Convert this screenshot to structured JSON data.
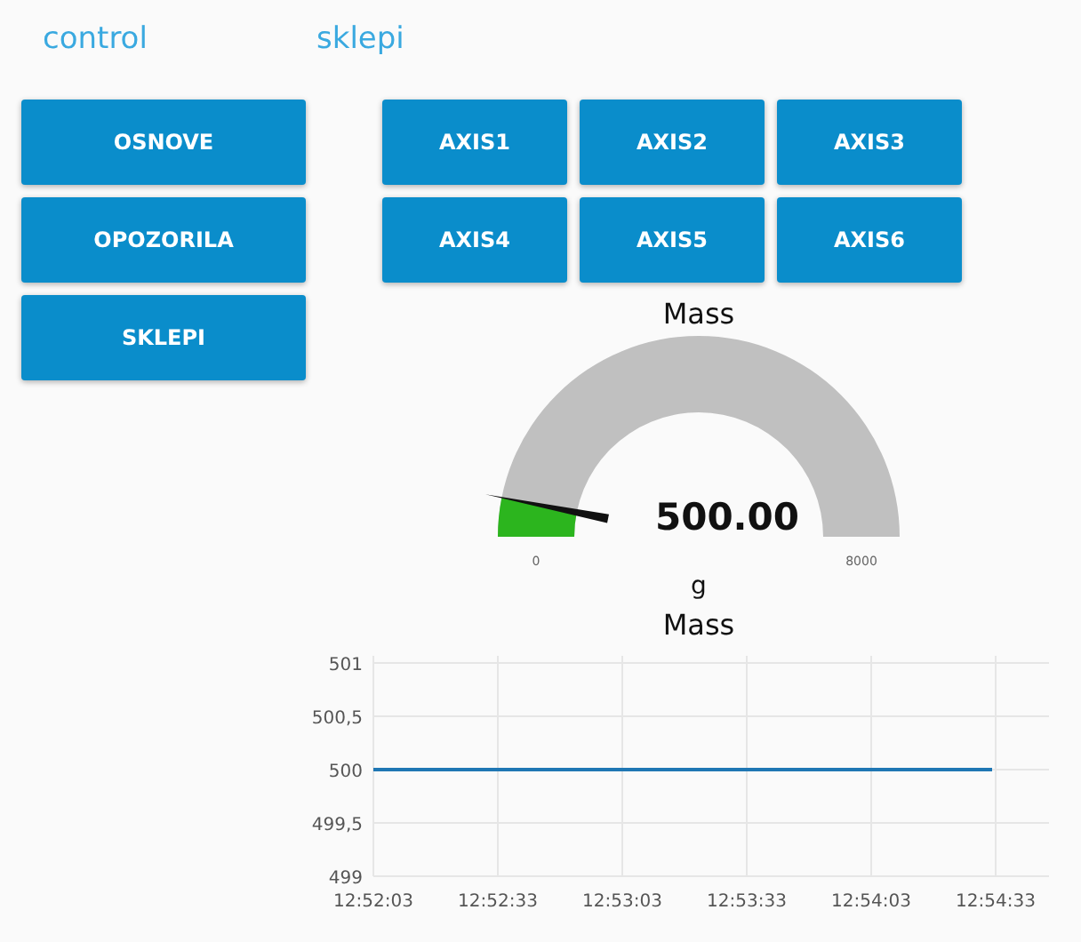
{
  "left_group": {
    "title": "control",
    "buttons": [
      "OSNOVE",
      "OPOZORILA",
      "SKLEPI"
    ]
  },
  "right_group": {
    "title": "sklepi",
    "buttons": [
      "AXIS1",
      "AXIS2",
      "AXIS3",
      "AXIS4",
      "AXIS5",
      "AXIS6"
    ]
  },
  "gauge": {
    "title": "Mass",
    "value": "500.00",
    "unit": "g",
    "min": "0",
    "max": "8000",
    "level": 0.0625
  },
  "chart": {
    "title": "Mass",
    "chart_data": {
      "type": "line",
      "categories": [
        "12:52:03",
        "12:52:33",
        "12:53:03",
        "12:53:33",
        "12:54:03",
        "12:54:33"
      ],
      "grid": true,
      "series": [
        {
          "color": "#1f77b4",
          "values": [
            500,
            500,
            500,
            500,
            500,
            500
          ]
        }
      ],
      "ylim": [
        499,
        501
      ],
      "yticks": [
        499,
        {
          "value": 499.5,
          "label": "499,5"
        },
        500,
        {
          "value": 500.5,
          "label": "500,5"
        },
        501
      ]
    }
  }
}
